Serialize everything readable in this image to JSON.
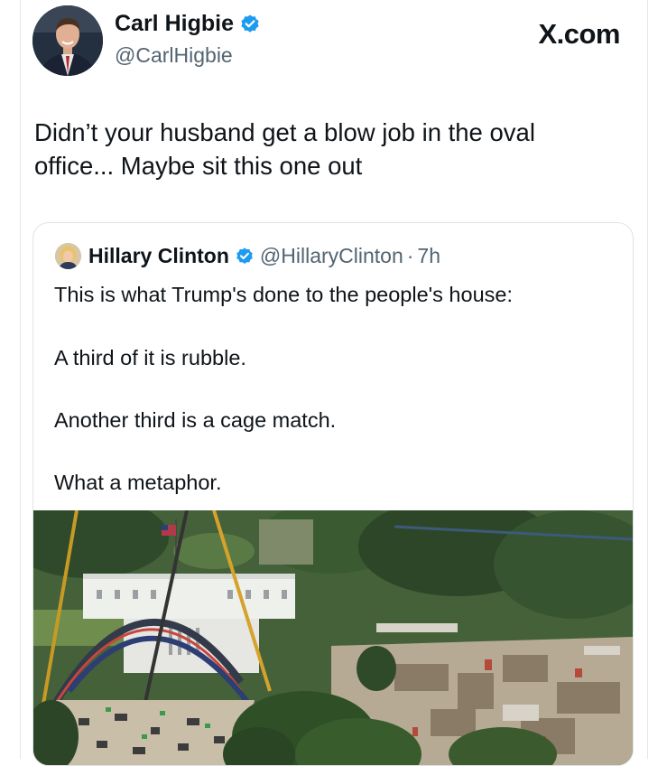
{
  "post": {
    "author_name": "Carl Higbie",
    "author_handle": "@CarlHigbie",
    "brand": "X.com",
    "text_line1": "Didn’t your husband get a blow job in the oval",
    "text_line2": "office... Maybe sit this one out"
  },
  "quoted": {
    "author_name": "Hillary Clinton",
    "author_handle": "@HillaryClinton",
    "separator": "·",
    "time": "7h",
    "lines": [
      "This is what Trump's done to the people's house:",
      "A third of it is rubble.",
      "Another third is a cage match.",
      "What a metaphor."
    ]
  },
  "colors": {
    "verified_blue": "#1d9bf0",
    "secondary_text": "#536471"
  },
  "icons": {
    "verified": "verified-badge-icon"
  }
}
